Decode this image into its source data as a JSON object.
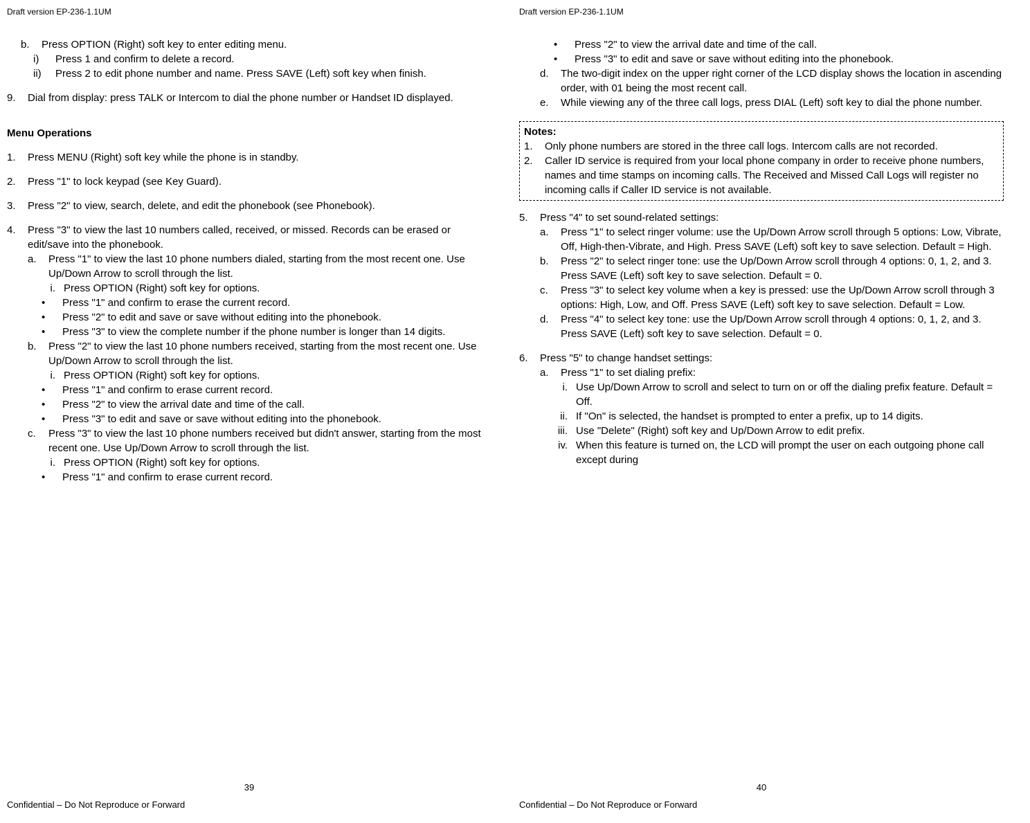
{
  "header": "Draft version EP-236-1.1UM",
  "footer": "Confidential – Do Not Reproduce or Forward",
  "page_left_num": "39",
  "page_right_num": "40",
  "left": {
    "s8b": "Press OPTION (Right) soft key to enter editing menu.",
    "s8b_i": "Press 1 and confirm to delete a record.",
    "s8b_ii": "Press 2 to edit phone number and name. Press SAVE (Left) soft key when finish.",
    "s9": "Dial from display: press TALK or Intercom to dial the phone number or Handset ID displayed.",
    "menu_heading": "Menu Operations",
    "m1": "Press MENU (Right) soft key while the phone is in standby.",
    "m2": "Press \"1\" to lock keypad (see Key Guard).",
    "m3": "Press \"2\" to view, search, delete, and edit the phonebook (see Phonebook).",
    "m4": "Press \"3\" to view the last 10 numbers called, received, or missed.  Records can be erased or edit/save into the phonebook.",
    "m4a": "Press \"1\" to view the last 10 phone numbers dialed, starting from the most recent one.  Use Up/Down Arrow to scroll through the list.",
    "m4a_i": "Press OPTION (Right) soft key for options.",
    "m4a_b1": "Press \"1\" and confirm to erase the current record.",
    "m4a_b2": "Press \"2\" to edit and save or save without editing into the phonebook.",
    "m4a_b3": "Press \"3\" to view the complete number if the phone number is longer than 14 digits.",
    "m4b": "Press \"2\" to view the last 10 phone numbers received, starting from the most recent one.  Use Up/Down Arrow to scroll through the list.",
    "m4b_i": "Press OPTION (Right) soft key for options.",
    "m4b_b1": "Press \"1\" and confirm to erase current record.",
    "m4b_b2": "Press \"2\" to view the arrival date and time of the call.",
    "m4b_b3": "Press \"3\" to edit and save or save without editing into the phonebook.",
    "m4c": "Press \"3\" to view the last 10 phone numbers received but didn't answer, starting from the most recent one.  Use Up/Down Arrow to scroll through the list.",
    "m4c_i": "Press OPTION (Right) soft key for options.",
    "m4c_b1": "Press \"1\" and confirm to erase current record."
  },
  "right": {
    "m4c_b2": "Press \"2\" to view the arrival date and time of the call.",
    "m4c_b3": "Press \"3\" to edit and save or save without editing into the phonebook.",
    "m4d": "The two-digit index on the upper right corner of the LCD display shows the location in ascending order, with 01 being the most recent call.",
    "m4e": "While viewing any of the three call logs, press DIAL (Left) soft key to dial the phone number.",
    "notes_title": "Notes:",
    "note1": "Only phone numbers are stored in the three call logs.  Intercom calls are not recorded.",
    "note2": "Caller ID service is required from your local phone company in order to receive phone numbers, names and time stamps on incoming calls.  The Received and Missed Call Logs will register no incoming calls if Caller ID service is not available.",
    "m5": "Press \"4\" to set sound-related settings:",
    "m5a": "Press \"1\" to select ringer volume: use the Up/Down Arrow scroll through 5 options: Low, Vibrate, Off, High-then-Vibrate, and High.  Press SAVE (Left) soft key to save selection.  Default = High.",
    "m5b": "Press \"2\" to select ringer tone: use the Up/Down Arrow scroll through 4 options: 0, 1, 2, and 3.  Press SAVE (Left) soft key to save selection.  Default = 0.",
    "m5c": "Press \"3\" to select key volume when a key is pressed: use the Up/Down Arrow scroll through 3 options: High, Low, and Off.  Press SAVE (Left) soft key to save selection.  Default = Low.",
    "m5d": "Press \"4\" to select key tone: use the Up/Down Arrow scroll through 4 options: 0, 1, 2, and 3.  Press SAVE (Left) soft key to save selection.  Default = 0.",
    "m6": "Press \"5\" to change handset settings:",
    "m6a": "Press \"1\" to set dialing prefix:",
    "m6a_i": "Use Up/Down Arrow to scroll and select to turn on or off the dialing prefix feature.  Default = Off.",
    "m6a_ii": "If \"On\" is selected, the handset is prompted to enter a prefix, up to 14 digits.",
    "m6a_iii": "Use \"Delete\" (Right) soft key and Up/Down Arrow to edit prefix.",
    "m6a_iv": "When this feature is turned on, the LCD will prompt the user on each outgoing phone call except during"
  }
}
